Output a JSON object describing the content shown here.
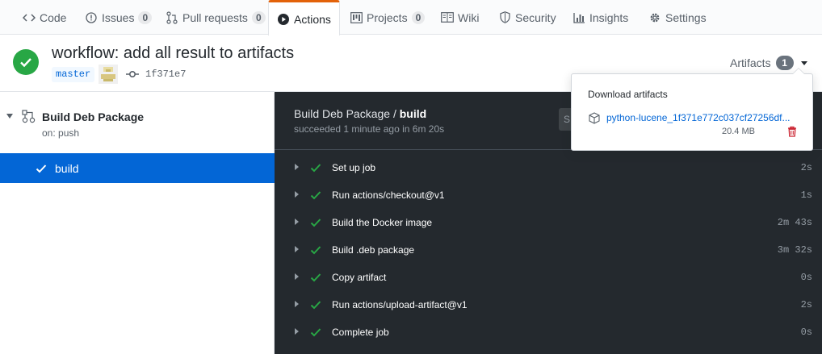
{
  "tabs": [
    {
      "label": "Code",
      "icon": "code-icon"
    },
    {
      "label": "Issues",
      "icon": "issue-icon",
      "count": "0"
    },
    {
      "label": "Pull requests",
      "icon": "pull-request-icon",
      "count": "0"
    },
    {
      "label": "Actions",
      "icon": "play-icon",
      "selected": true
    },
    {
      "label": "Projects",
      "icon": "project-icon",
      "count": "0"
    },
    {
      "label": "Wiki",
      "icon": "book-icon"
    },
    {
      "label": "Security",
      "icon": "shield-icon"
    },
    {
      "label": "Insights",
      "icon": "graph-icon"
    },
    {
      "label": "Settings",
      "icon": "gear-icon"
    }
  ],
  "run": {
    "title": "workflow: add all result to artifacts",
    "branch": "master",
    "commit": "1f371e7",
    "status": "success",
    "artifacts_label": "Artifacts",
    "artifacts_count": "1"
  },
  "sidebar": {
    "workflow_name": "Build Deb Package",
    "trigger": "on: push",
    "job": "build"
  },
  "log": {
    "workflow": "Build Deb Package",
    "separator": " / ",
    "job": "build",
    "summary": "succeeded 1 minute ago in 6m 20s",
    "search_hint": "S",
    "steps": [
      {
        "name": "Set up job",
        "duration": "2s"
      },
      {
        "name": "Run actions/checkout@v1",
        "duration": "1s"
      },
      {
        "name": "Build the Docker image",
        "duration": "2m 43s"
      },
      {
        "name": "Build .deb package",
        "duration": "3m 32s"
      },
      {
        "name": "Copy artifact",
        "duration": "0s"
      },
      {
        "name": "Run actions/upload-artifact@v1",
        "duration": "2s"
      },
      {
        "name": "Complete job",
        "duration": "0s"
      }
    ]
  },
  "popover": {
    "title": "Download artifacts",
    "artifact_name": "python-lucene_1f371e772c037cf27256df...",
    "artifact_size": "20.4 MB"
  },
  "colors": {
    "accent": "#e36209",
    "success": "#28a745",
    "link": "#0366d6",
    "log_bg": "#24292e",
    "danger": "#cb2431"
  }
}
